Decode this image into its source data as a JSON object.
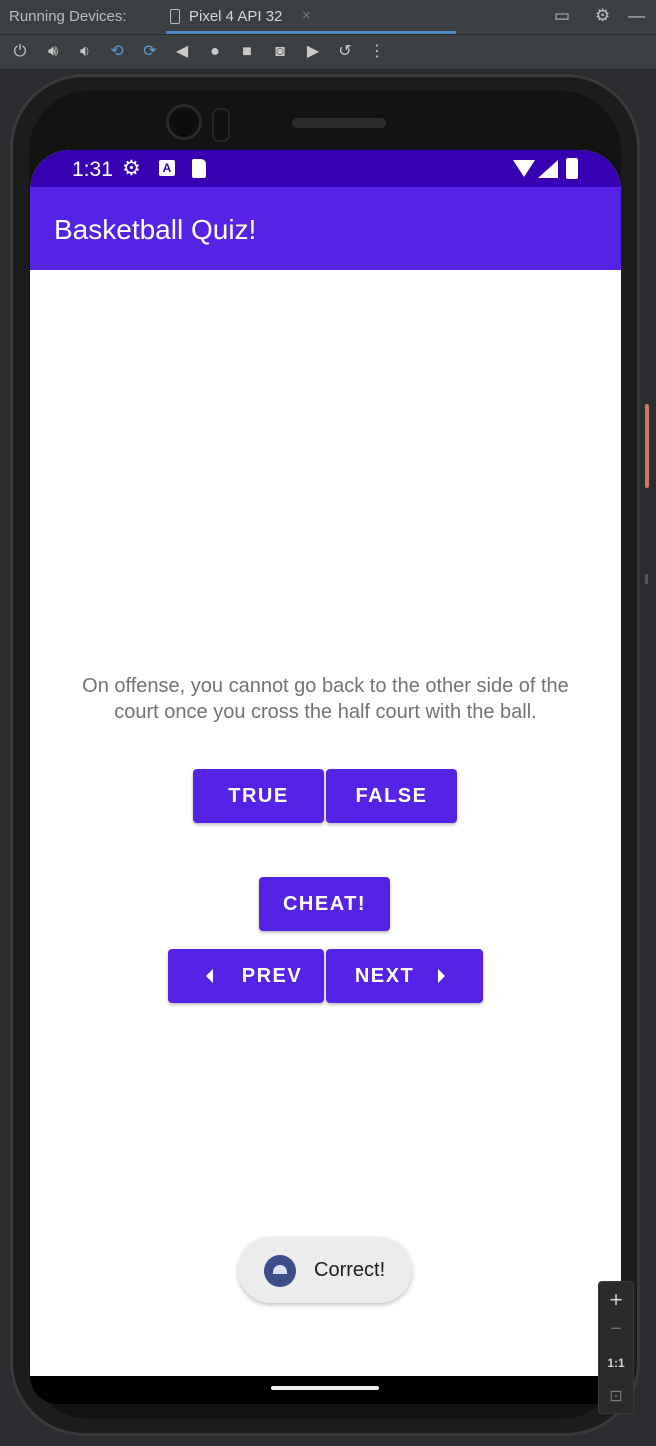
{
  "ide": {
    "panel_title": "Running Devices:",
    "device_tab_label": "Pixel 4 API 32",
    "tab_close": "×",
    "toolbar_icons": [
      "power-icon",
      "volume-up-icon",
      "volume-down-icon",
      "rotate-left-icon",
      "rotate-right-icon",
      "back-icon",
      "home-icon",
      "overview-icon",
      "camera-icon",
      "video-icon",
      "reset-icon",
      "more-icon"
    ],
    "right_icons": [
      "window-icon",
      "gear-icon",
      "minimize-icon"
    ]
  },
  "statusbar": {
    "time": "1:31",
    "icons": [
      "gear-icon",
      "a-icon",
      "sd-card-icon",
      "wifi-icon",
      "signal-icon",
      "battery-icon"
    ],
    "a_letter": "A"
  },
  "app": {
    "title": "Basketball Quiz!",
    "question": "On offense, you cannot go back to the other side of the court once you cross the half court with the ball.",
    "true_label": "TRUE",
    "false_label": "FALSE",
    "cheat_label": "CHEAT!",
    "prev_label": "PREV",
    "next_label": "NEXT",
    "toast_text": "Correct!",
    "colors": {
      "status_bar": "#3700b3",
      "primary": "#5623e6",
      "question_text": "#737373"
    }
  },
  "zoom_panel": {
    "plus": "+",
    "minus": "−",
    "one_to_one": "1:1"
  }
}
